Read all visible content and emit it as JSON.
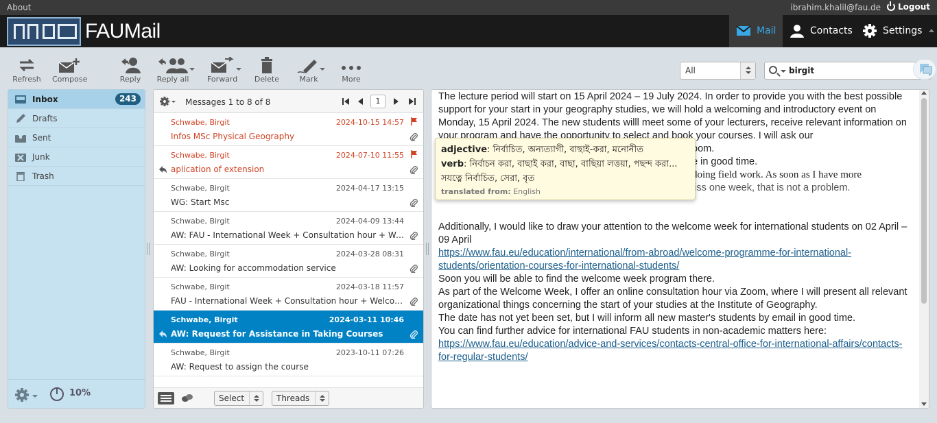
{
  "topline": {
    "about": "About",
    "user": "ibrahim.khalil@fau.de",
    "logout": "Logout"
  },
  "logo": {
    "text": "FAUMail"
  },
  "taskbar": [
    {
      "label": "Mail",
      "icon": "mail-icon",
      "active": true
    },
    {
      "label": "Contacts",
      "icon": "person-icon"
    },
    {
      "label": "Settings",
      "icon": "gear-icon"
    }
  ],
  "toolbar": {
    "refresh": "Refresh",
    "compose": "Compose",
    "reply": "Reply",
    "reply_all": "Reply all",
    "forward": "Forward",
    "delete": "Delete",
    "mark": "Mark",
    "more": "More"
  },
  "filter": {
    "selected": "All"
  },
  "search": {
    "query": "birgit"
  },
  "folders": [
    {
      "name": "Inbox",
      "count": "243",
      "icon": "inbox-icon"
    },
    {
      "name": "Drafts",
      "icon": "pencil-icon"
    },
    {
      "name": "Sent",
      "icon": "sent-icon"
    },
    {
      "name": "Junk",
      "icon": "junk-icon"
    },
    {
      "name": "Trash",
      "icon": "trash-icon"
    }
  ],
  "quota": "10%",
  "messagelist": {
    "count_text": "Messages 1 to 8 of 8",
    "page": "1",
    "messages": [
      {
        "from": "Schwabe, Birgit",
        "date": "2024-10-15 14:57",
        "subject": "Infos MSc Physical Geography",
        "flagged": true,
        "attachment": true
      },
      {
        "from": "Schwabe, Birgit",
        "date": "2024-07-10 11:55",
        "subject": "aplication of extension",
        "flagged": true,
        "attachment": true,
        "replied": true
      },
      {
        "from": "Schwabe, Birgit",
        "date": "2024-04-17 13:15",
        "subject": "WG: Start Msc",
        "attachment": true
      },
      {
        "from": "Schwabe, Birgit",
        "date": "2024-04-09 13:44",
        "subject": "AW: FAU - International Week + Consultation hour + Welcome Week",
        "attachment": true
      },
      {
        "from": "Schwabe, Birgit",
        "date": "2024-03-28 08:31",
        "subject": "AW: Looking for accommodation service",
        "attachment": true
      },
      {
        "from": "Schwabe, Birgit",
        "date": "2024-03-18 11:57",
        "subject": "FAU - International Week + Consultation hour + Welcome Week",
        "attachment": true
      },
      {
        "from": "Schwabe, Birgit",
        "date": "2024-03-11 10:46",
        "subject": "AW: Request for Assistance in Taking Courses",
        "selected": true,
        "attachment": true,
        "replied": true
      },
      {
        "from": "Schwabe, Birgit",
        "date": "2023-10-11 07:26",
        "subject": "AW: Request to assign the course"
      }
    ],
    "select_label": "Select",
    "threads_label": "Threads"
  },
  "preview": {
    "p1": "The lecture period will start on 15 April 2024 – 19 July 2024.  In order to provide you with the best possible support for your start in your geography studies, we will hold a welcoming and introductory event on Monday, 15 April 2024. The new students willl meet some of your lecturers, receive relevant information on your program and have the opportunity to select and book your courses. I will ask our",
    "p1_tail": "oom.",
    "p2_tail": "e in good time.",
    "p3_tail": "doing field work. As soon as I have more",
    "p4": "Some of your classes need attendance, but you will just miss one week, that is not a problem.",
    "p5": "Additionally, I would like to draw your attention to the welcome week for international students on 02 April – 09 April",
    "link1": "https://www.fau.eu/education/international/from-abroad/welcome-programme-for-international-students/orientation-courses-for-international-students/",
    "p6": "Soon you will be able to find the welcome week program there.",
    "p7": " As part of the Welcome Week, I offer an online consultation hour via Zoom, where I will present all relevant organizational things concerning the start of your studies at the Institute of Geography.",
    "p8": "The date has not yet been set, but I will inform all new master's students by email in good time.",
    "p9": "You can find further advice for international FAU students in non-academic matters here:",
    "link2": "https://www.fau.eu/education/advice-and-services/contacts-central-office-for-international-affairs/contacts-for-regular-students/"
  },
  "tooltip": {
    "adj_label": "adjective",
    "adj_text": ": নির্বাচিত, অন্যত্যাগী, বাছাই-করা, মনোনীত",
    "verb_label": "verb",
    "verb_text": ": নির্বাচন করা, বাছাই করা, বাছা, বাছিয়া লত্তয়া, পছন্দ করা...",
    "line3": "সযত্নে নির্বাচিত, সেরা, বৃত",
    "translated_label": "translated from:",
    "translated_lang": "English"
  },
  "colors": {
    "accent": "#0082c4",
    "flag": "#d04324",
    "folder_bg": "#c6e1f0",
    "badge": "#1f5f82"
  }
}
